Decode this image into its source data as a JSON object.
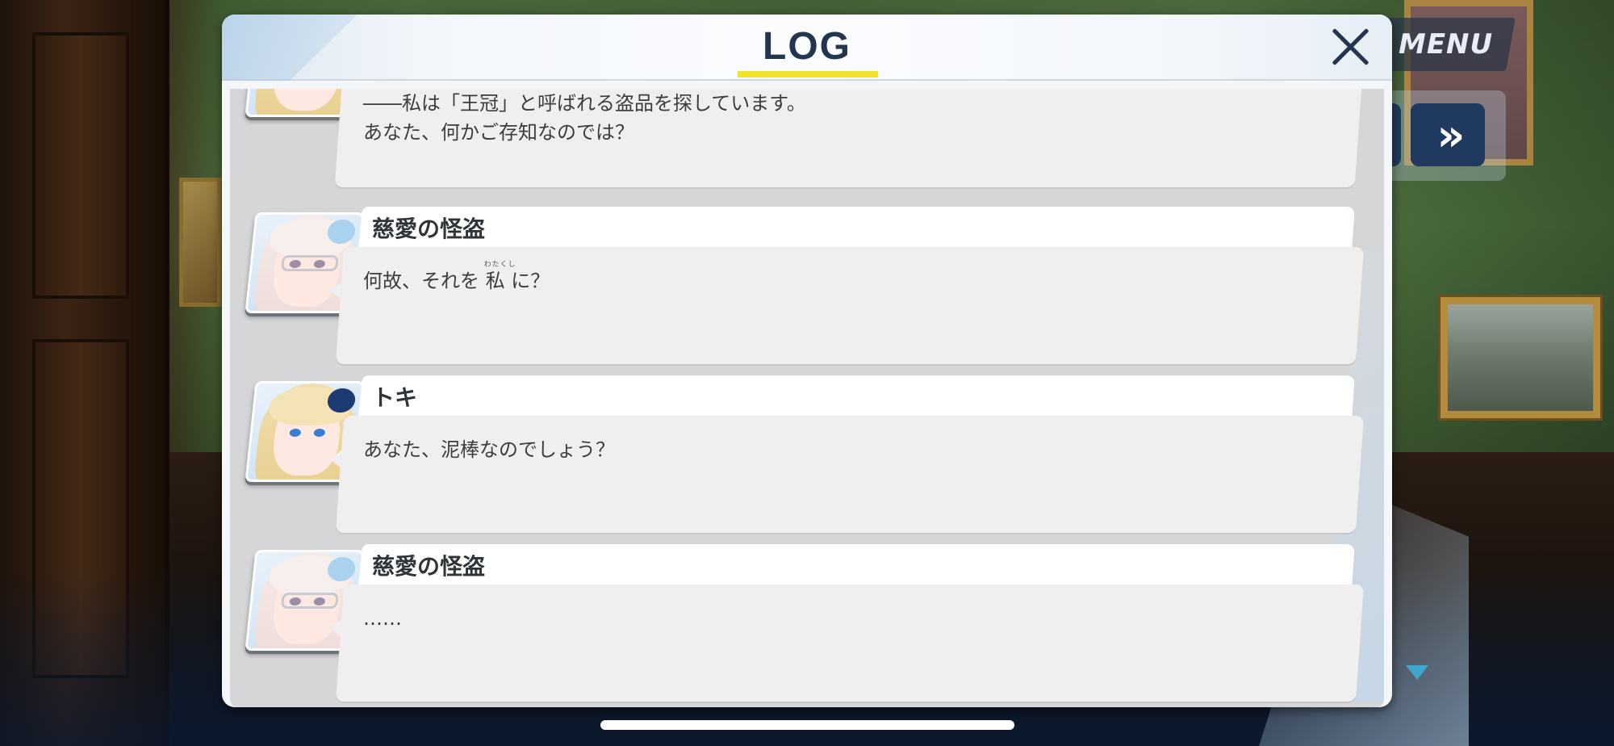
{
  "hud": {
    "menu_label": "MENU",
    "fast_forward_glyph": "»"
  },
  "log": {
    "title": "LOG",
    "close_glyph": "×",
    "entries": [
      {
        "speaker": "",
        "portrait": "blonde",
        "lines": [
          "――私は「王冠」と呼ばれる盗品を探しています。",
          "あなた、何かご存知なのでは？"
        ]
      },
      {
        "speaker": "慈愛の怪盗",
        "portrait": "pink",
        "text_before": "何故、それを ",
        "ruby_base": "私",
        "ruby_reading": "わたくし",
        "text_after": " に？"
      },
      {
        "speaker": "トキ",
        "portrait": "blonde",
        "lines": [
          "あなた、泥棒なのでしょう？"
        ]
      },
      {
        "speaker": "慈愛の怪盗",
        "portrait": "pink",
        "lines": [
          "……"
        ]
      }
    ]
  },
  "colors": {
    "title_text": "#23354f",
    "title_underline": "#f2e22c",
    "menu_bg": "#283448",
    "ff_button": "#1f3a5e",
    "advance_arrow": "#3fa7c9"
  }
}
